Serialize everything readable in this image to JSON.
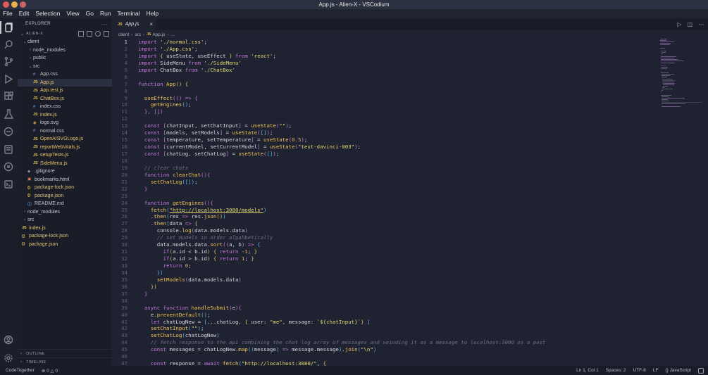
{
  "window": {
    "title": "App.js - Alien-X - VSCodium"
  },
  "menu": [
    "File",
    "Edit",
    "Selection",
    "View",
    "Go",
    "Run",
    "Terminal",
    "Help"
  ],
  "activity_bar": {
    "items": [
      "explorer-icon",
      "search-icon",
      "source-control-icon",
      "run-debug-icon",
      "extensions-icon",
      "testing-icon",
      "remote-icon",
      "docker-icon",
      "github-icon",
      "terminal-icon"
    ],
    "bottom": [
      "account-icon",
      "settings-icon"
    ]
  },
  "sidebar": {
    "header": "EXPLORER",
    "root": "ALIEN-X",
    "tree": [
      {
        "depth": 1,
        "type": "folder",
        "open": true,
        "name": "client"
      },
      {
        "depth": 2,
        "type": "folder",
        "open": false,
        "name": "node_modules"
      },
      {
        "depth": 2,
        "type": "folder",
        "open": false,
        "name": "public"
      },
      {
        "depth": 2,
        "type": "folder",
        "open": true,
        "name": "src"
      },
      {
        "depth": 3,
        "type": "css",
        "name": "App.css"
      },
      {
        "depth": 3,
        "type": "js",
        "name": "App.js",
        "selected": true
      },
      {
        "depth": 3,
        "type": "js",
        "name": "App.test.js"
      },
      {
        "depth": 3,
        "type": "js",
        "name": "ChatBox.js"
      },
      {
        "depth": 3,
        "type": "css",
        "name": "index.css"
      },
      {
        "depth": 3,
        "type": "js",
        "name": "index.js"
      },
      {
        "depth": 3,
        "type": "svg",
        "name": "logo.svg"
      },
      {
        "depth": 3,
        "type": "css",
        "name": "normal.css"
      },
      {
        "depth": 3,
        "type": "js",
        "name": "OpenAISVGLogo.js"
      },
      {
        "depth": 3,
        "type": "js",
        "name": "reportWebVitals.js"
      },
      {
        "depth": 3,
        "type": "js",
        "name": "setupTests.js"
      },
      {
        "depth": 3,
        "type": "js",
        "name": "SideMenu.js"
      },
      {
        "depth": 2,
        "type": "git",
        "name": ".gitignore"
      },
      {
        "depth": 2,
        "type": "html",
        "name": "bookmarks.html"
      },
      {
        "depth": 2,
        "type": "json",
        "name": "package-lock.json"
      },
      {
        "depth": 2,
        "type": "json",
        "name": "package.json"
      },
      {
        "depth": 2,
        "type": "md",
        "name": "README.md"
      },
      {
        "depth": 1,
        "type": "folder",
        "open": false,
        "name": "node_modules"
      },
      {
        "depth": 1,
        "type": "folder",
        "open": false,
        "name": "src"
      },
      {
        "depth": 1,
        "type": "js",
        "name": "index.js"
      },
      {
        "depth": 1,
        "type": "json",
        "name": "package-lock.json"
      },
      {
        "depth": 1,
        "type": "json",
        "name": "package.json"
      }
    ],
    "outline": "OUTLINE",
    "timeline": "TIMELINE"
  },
  "icon_glyphs": {
    "css": "#",
    "js": "JS",
    "json": "{}",
    "svg": "◉",
    "git": "◆",
    "html": "▣",
    "md": "ⓘ"
  },
  "editor": {
    "tab": {
      "label": "App.js",
      "badge": "JS",
      "close": "×"
    },
    "breadcrumb": [
      "client",
      "src",
      "App.js",
      "..."
    ],
    "breadcrumb_badge": "JS",
    "lines": [
      [
        [
          "k",
          "import "
        ],
        [
          "s",
          "'./normal.css'"
        ],
        [
          "p",
          ";"
        ]
      ],
      [
        [
          "k",
          "import "
        ],
        [
          "s",
          "'./App.css'"
        ],
        [
          "p",
          ";"
        ]
      ],
      [
        [
          "k",
          "import "
        ],
        [
          "b1",
          "{ "
        ],
        [
          "v",
          "useState, useEffect "
        ],
        [
          "b1",
          "}"
        ],
        [
          "k",
          " from "
        ],
        [
          "s",
          "'react'"
        ],
        [
          "p",
          ";"
        ]
      ],
      [
        [
          "k",
          "import "
        ],
        [
          "v",
          "SideMenu "
        ],
        [
          "k",
          "from "
        ],
        [
          "s",
          "'./SideMenu'"
        ]
      ],
      [
        [
          "k",
          "import "
        ],
        [
          "v",
          "ChatBox "
        ],
        [
          "k",
          "from "
        ],
        [
          "s",
          "'./ChatBox'"
        ]
      ],
      [],
      [
        [
          "k",
          "function "
        ],
        [
          "fn",
          "App"
        ],
        [
          "b1",
          "() {"
        ]
      ],
      [],
      [
        [
          "p",
          "  "
        ],
        [
          "fn",
          "useEffect"
        ],
        [
          "b2",
          "(() => {"
        ]
      ],
      [
        [
          "p",
          "    "
        ],
        [
          "fn",
          "getEngines"
        ],
        [
          "b3",
          "()"
        ],
        [
          "p",
          ";"
        ]
      ],
      [
        [
          "p",
          "  "
        ],
        [
          "b2",
          "}, []"
        ],
        [
          "b2",
          ")"
        ]
      ],
      [],
      [
        [
          "p",
          "  "
        ],
        [
          "k",
          "const "
        ],
        [
          "b2",
          "["
        ],
        [
          "v",
          "chatInput, setChatInput"
        ],
        [
          "b2",
          "]"
        ],
        [
          "p",
          " = "
        ],
        [
          "fn",
          "useState"
        ],
        [
          "b2",
          "("
        ],
        [
          "s",
          "\"\""
        ],
        [
          "b2",
          ")"
        ],
        [
          "p",
          ";"
        ]
      ],
      [
        [
          "p",
          "  "
        ],
        [
          "k",
          "const "
        ],
        [
          "b2",
          "["
        ],
        [
          "v",
          "models, setModels"
        ],
        [
          "b2",
          "]"
        ],
        [
          "p",
          " = "
        ],
        [
          "fn",
          "useState"
        ],
        [
          "b2",
          "("
        ],
        [
          "b3",
          "[]"
        ],
        [
          "b2",
          ")"
        ],
        [
          "p",
          ";"
        ]
      ],
      [
        [
          "p",
          "  "
        ],
        [
          "k",
          "const "
        ],
        [
          "b2",
          "["
        ],
        [
          "v",
          "temperature, setTemperature"
        ],
        [
          "b2",
          "]"
        ],
        [
          "p",
          " = "
        ],
        [
          "fn",
          "useState"
        ],
        [
          "b2",
          "("
        ],
        [
          "n",
          "0.5"
        ],
        [
          "b2",
          ")"
        ],
        [
          "p",
          ";"
        ]
      ],
      [
        [
          "p",
          "  "
        ],
        [
          "k",
          "const "
        ],
        [
          "b2",
          "["
        ],
        [
          "v",
          "currentModel, setCurrentModel"
        ],
        [
          "b2",
          "]"
        ],
        [
          "p",
          " = "
        ],
        [
          "fn",
          "useState"
        ],
        [
          "b2",
          "("
        ],
        [
          "s",
          "\"text-davinci-003\""
        ],
        [
          "b2",
          ")"
        ],
        [
          "p",
          ";"
        ]
      ],
      [
        [
          "p",
          "  "
        ],
        [
          "k",
          "const "
        ],
        [
          "b2",
          "["
        ],
        [
          "v",
          "chatLog, setChatLog"
        ],
        [
          "b2",
          "]"
        ],
        [
          "p",
          " = "
        ],
        [
          "fn",
          "useState"
        ],
        [
          "b2",
          "("
        ],
        [
          "b3",
          "[]"
        ],
        [
          "b2",
          ")"
        ],
        [
          "p",
          ";"
        ]
      ],
      [],
      [
        [
          "c",
          "  // clear chats"
        ]
      ],
      [
        [
          "p",
          "  "
        ],
        [
          "k",
          "function "
        ],
        [
          "fn",
          "clearChat"
        ],
        [
          "b2",
          "(){"
        ]
      ],
      [
        [
          "p",
          "    "
        ],
        [
          "fn",
          "setChatLog"
        ],
        [
          "b3",
          "([])"
        ],
        [
          "p",
          ";"
        ]
      ],
      [
        [
          "p",
          "  "
        ],
        [
          "b2",
          "}"
        ]
      ],
      [],
      [
        [
          "p",
          "  "
        ],
        [
          "k",
          "function "
        ],
        [
          "fn",
          "getEngines"
        ],
        [
          "b2",
          "(){"
        ]
      ],
      [
        [
          "p",
          "    "
        ],
        [
          "fn",
          "fetch"
        ],
        [
          "b3",
          "("
        ],
        [
          "s",
          "\"http://localhost:3080/models\""
        ],
        [
          "b3",
          ")"
        ]
      ],
      [
        [
          "p",
          "    ."
        ],
        [
          "fn",
          "then"
        ],
        [
          "b3",
          "("
        ],
        [
          "v",
          "res "
        ],
        [
          "k",
          "=> "
        ],
        [
          "v",
          "res."
        ],
        [
          "fn",
          "json"
        ],
        [
          "b1",
          "()"
        ],
        [
          "b3",
          ")"
        ]
      ],
      [
        [
          "p",
          "    ."
        ],
        [
          "fn",
          "then"
        ],
        [
          "b3",
          "("
        ],
        [
          "v",
          "data "
        ],
        [
          "k",
          "=> "
        ],
        [
          "b1",
          "{"
        ]
      ],
      [
        [
          "p",
          "      "
        ],
        [
          "v",
          "console."
        ],
        [
          "fn",
          "log"
        ],
        [
          "b2",
          "("
        ],
        [
          "v",
          "data.models.data"
        ],
        [
          "b2",
          ")"
        ]
      ],
      [
        [
          "c",
          "      // set models in order alpahbetically"
        ]
      ],
      [
        [
          "p",
          "      "
        ],
        [
          "v",
          "data.models.data."
        ],
        [
          "fn",
          "sort"
        ],
        [
          "b2",
          "(("
        ],
        [
          "v",
          "a, b"
        ],
        [
          "b2",
          ")"
        ],
        [
          "k",
          " => "
        ],
        [
          "b3",
          "{"
        ]
      ],
      [
        [
          "p",
          "        "
        ],
        [
          "k",
          "if"
        ],
        [
          "b1",
          "("
        ],
        [
          "v",
          "a.id < b.id"
        ],
        [
          "b1",
          ")"
        ],
        [
          "b1",
          " { "
        ],
        [
          "k",
          "return "
        ],
        [
          "n",
          "-1"
        ],
        [
          "p",
          "; "
        ],
        [
          "b1",
          "}"
        ]
      ],
      [
        [
          "p",
          "        "
        ],
        [
          "k",
          "if"
        ],
        [
          "b1",
          "("
        ],
        [
          "v",
          "a.id > b.id"
        ],
        [
          "b1",
          ")"
        ],
        [
          "b1",
          " { "
        ],
        [
          "k",
          "return "
        ],
        [
          "n",
          "1"
        ],
        [
          "p",
          "; "
        ],
        [
          "b1",
          "}"
        ]
      ],
      [
        [
          "p",
          "        "
        ],
        [
          "k",
          "return "
        ],
        [
          "n",
          "0"
        ],
        [
          "p",
          ";"
        ]
      ],
      [
        [
          "p",
          "      "
        ],
        [
          "b3",
          "})"
        ]
      ],
      [
        [
          "p",
          "      "
        ],
        [
          "fn",
          "setModels"
        ],
        [
          "b2",
          "("
        ],
        [
          "v",
          "data.models.data"
        ],
        [
          "b2",
          ")"
        ]
      ],
      [
        [
          "p",
          "    "
        ],
        [
          "b1",
          "})"
        ]
      ],
      [
        [
          "p",
          "  "
        ],
        [
          "b2",
          "}"
        ]
      ],
      [],
      [
        [
          "p",
          "  "
        ],
        [
          "k",
          "async function "
        ],
        [
          "fn",
          "handleSubmit"
        ],
        [
          "b2",
          "("
        ],
        [
          "v",
          "e"
        ],
        [
          "b2",
          "){"
        ]
      ],
      [
        [
          "p",
          "    "
        ],
        [
          "v",
          "e."
        ],
        [
          "fn",
          "preventDefault"
        ],
        [
          "b3",
          "()"
        ],
        [
          "p",
          ";"
        ]
      ],
      [
        [
          "p",
          "    "
        ],
        [
          "k",
          "let "
        ],
        [
          "v",
          "chatLogNew = "
        ],
        [
          "b3",
          "["
        ],
        [
          "v",
          "...chatLog, "
        ],
        [
          "b1",
          "{ "
        ],
        [
          "v",
          "user: "
        ],
        [
          "s",
          "\"me\""
        ],
        [
          "v",
          ", message: "
        ],
        [
          "s",
          "`${chatInput}`"
        ],
        [
          "b1",
          "} "
        ],
        [
          "b3",
          "]"
        ]
      ],
      [
        [
          "p",
          "    "
        ],
        [
          "fn",
          "setChatInput"
        ],
        [
          "b3",
          "("
        ],
        [
          "s",
          "\"\""
        ],
        [
          "b3",
          ")"
        ],
        [
          "p",
          ";"
        ]
      ],
      [
        [
          "p",
          "    "
        ],
        [
          "fn",
          "setChatLog"
        ],
        [
          "b3",
          "("
        ],
        [
          "v",
          "chatLogNew"
        ],
        [
          "b3",
          ")"
        ]
      ],
      [
        [
          "c",
          "    // fetch response to the api combining the chat log array of messages and seinding it as a message to localhost:3000 as a post"
        ]
      ],
      [
        [
          "p",
          "    "
        ],
        [
          "k",
          "const "
        ],
        [
          "v",
          "messages = chatLogNew."
        ],
        [
          "fn",
          "map"
        ],
        [
          "b3",
          "(("
        ],
        [
          "v",
          "message"
        ],
        [
          "b3",
          ")"
        ],
        [
          "k",
          " => "
        ],
        [
          "v",
          "message.message"
        ],
        [
          "b3",
          ")"
        ],
        [
          "p",
          "."
        ],
        [
          "fn",
          "join"
        ],
        [
          "b3",
          "("
        ],
        [
          "s",
          "\"\\n\""
        ],
        [
          "b3",
          ")"
        ]
      ],
      [],
      [
        [
          "p",
          "    "
        ],
        [
          "k",
          "const "
        ],
        [
          "v",
          "response = "
        ],
        [
          "k",
          "await "
        ],
        [
          "fn",
          "fetch"
        ],
        [
          "b3",
          "("
        ],
        [
          "s",
          "\"http://localhost:3080/\""
        ],
        [
          "p",
          ", "
        ],
        [
          "b1",
          "{"
        ]
      ]
    ],
    "actions": [
      "▷",
      "◫",
      "⋯"
    ]
  },
  "statusbar": {
    "left": [
      "CodeTogether",
      "⊗ 0 △ 0"
    ],
    "right": [
      "Ln 1, Col 1",
      "Spaces: 2",
      "UTF-8",
      "LF",
      "{} JavaScript"
    ]
  }
}
